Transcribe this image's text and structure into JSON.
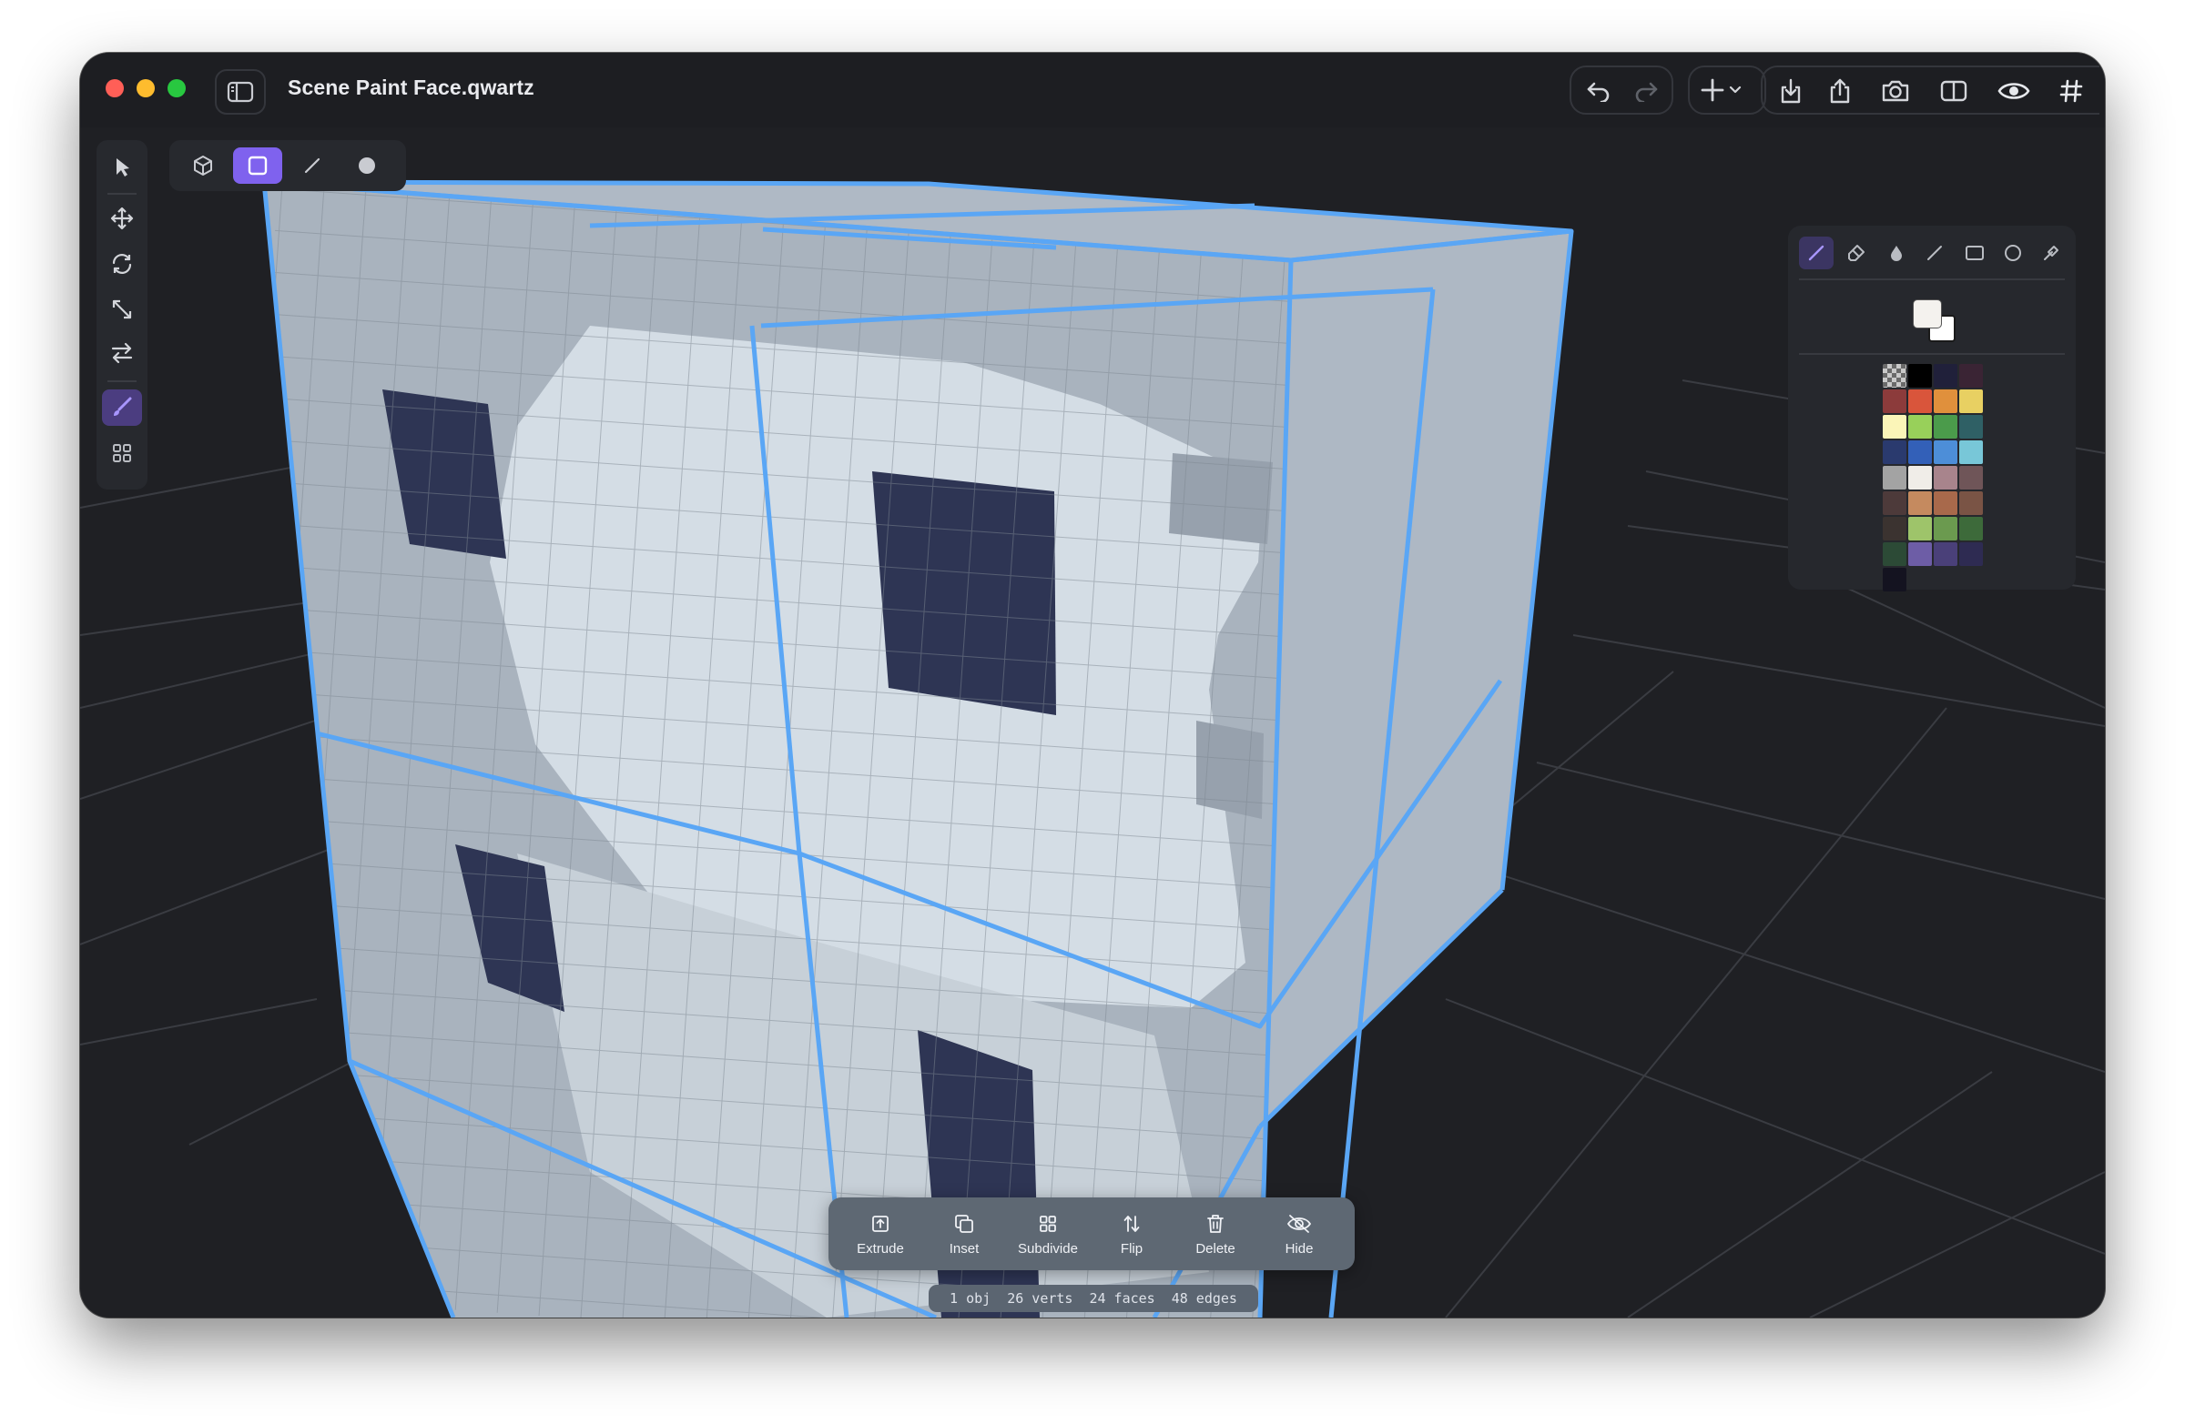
{
  "window": {
    "title": "Scene Paint Face.qwartz"
  },
  "titlebar_icons": {
    "sidebar": "sidebar-icon",
    "undo": "undo-icon",
    "redo": "redo-icon",
    "add": "plus-icon",
    "import": "import-icon",
    "share": "share-icon",
    "snapshot": "camera-icon",
    "split": "split-view-icon",
    "preview": "eye-icon",
    "grid": "hash-icon"
  },
  "left_tools": [
    "select",
    "move",
    "rotate",
    "scale",
    "mirror",
    "paint",
    "uv-grid"
  ],
  "selection_modes": [
    "object",
    "face",
    "edge",
    "vertex"
  ],
  "paint_tools": [
    "brush",
    "eraser",
    "fill",
    "line",
    "rectangle",
    "ellipse",
    "eyedropper"
  ],
  "colors": {
    "accent": "#7f62ee",
    "edge_highlight": "#5aa6f5",
    "viewport": "#1f2024",
    "current_primary": "#f4f2ee",
    "current_secondary": "#ffffff"
  },
  "palette": [
    "transparent",
    "#000000",
    "#20203a",
    "#3a2434",
    "#8c3b3b",
    "#d9553b",
    "#e0903c",
    "#e8d062",
    "#fbf5b8",
    "#98d05a",
    "#4b9b4b",
    "#2f6065",
    "#2a3a6e",
    "#3360b8",
    "#4d8ed8",
    "#78c7d8",
    "#a3a3a3",
    "#f0ede8",
    "#a8848c",
    "#6f5558",
    "#4d3a3a",
    "#c58a5f",
    "#a8694b",
    "#7a5445",
    "#3b3330",
    "#9ec46a",
    "#6b9a4f",
    "#3d6a3a",
    "#2c4a36",
    "#6d5da6",
    "#4a4079",
    "#2e2b52",
    "#141320"
  ],
  "bottom_actions": [
    {
      "label": "Extrude",
      "icon": "extrude-icon"
    },
    {
      "label": "Inset",
      "icon": "inset-icon"
    },
    {
      "label": "Subdivide",
      "icon": "subdivide-icon"
    },
    {
      "label": "Flip",
      "icon": "flip-icon"
    },
    {
      "label": "Delete",
      "icon": "trash-icon"
    },
    {
      "label": "Hide",
      "icon": "eye-off-icon"
    }
  ],
  "stats": {
    "objects": "1 obj",
    "verts": "26 verts",
    "faces": "24 faces",
    "edges": "48 edges"
  }
}
